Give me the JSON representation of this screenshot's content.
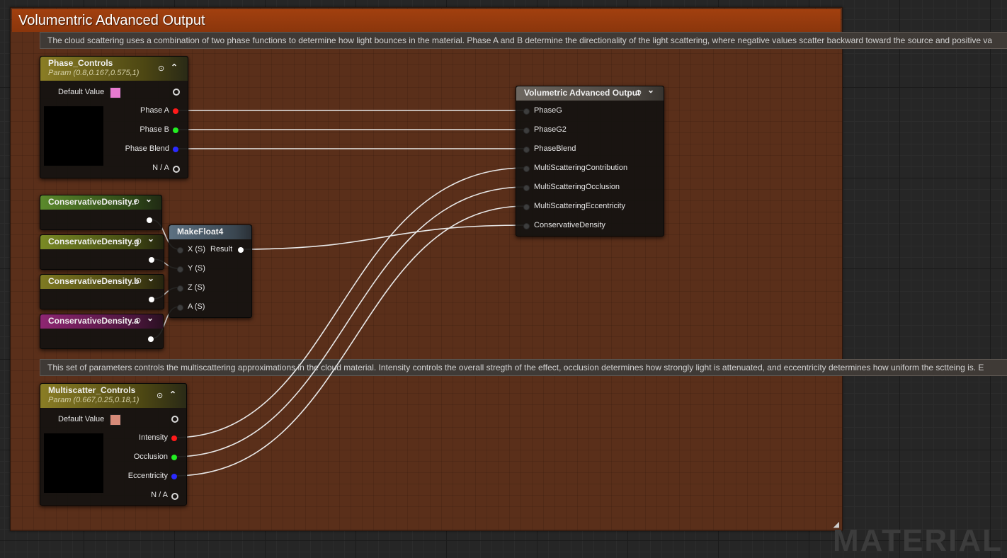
{
  "comment": {
    "title": "Volumentric Advanced Output",
    "resize_glyph": "◢",
    "color": "#5a2f1a",
    "header_color": "#8b360c"
  },
  "bubbles": {
    "phase_note": "The cloud scattering uses a combination of two phase functions to determine how light bounces in the material.  Phase A and B determine the directionality of the light scattering, where negative values scatter backward toward the source and positive va",
    "multiscatter_note": "This set of parameters controls the multiscattering approximations in the cloud material.  Intensity controls the overall stregth of the effect, occlusion determines how strongly light is attenuated, and eccentricity determines how uniform the sctteing is.  E"
  },
  "phase_controls": {
    "title": "Phase_Controls",
    "subtitle": "Param (0.8,0.167,0.575,1)",
    "default_value_label": "Default Value",
    "swatch_color": "#e77bd0",
    "pins": [
      "Phase A",
      "Phase B",
      "Phase Blend",
      "N / A"
    ]
  },
  "conservative_nodes": [
    {
      "title": "ConservativeDensity.r",
      "color": "#5b8a2c"
    },
    {
      "title": "ConservativeDensity.g",
      "color": "#7a8a25"
    },
    {
      "title": "ConservativeDensity.b",
      "color": "#7f7a22"
    },
    {
      "title": "ConservativeDensity.a",
      "color": "#8e2672"
    }
  ],
  "make_float4": {
    "title": "MakeFloat4",
    "inputs": [
      "X (S)",
      "Y (S)",
      "Z (S)",
      "A (S)"
    ],
    "output": "Result"
  },
  "output_node": {
    "title": "Volumetric Advanced Output",
    "inputs": [
      "PhaseG",
      "PhaseG2",
      "PhaseBlend",
      "MultiScatteringContribution",
      "MultiScatteringOcclusion",
      "MultiScatteringEccentricity",
      "ConservativeDensity"
    ]
  },
  "multiscatter_controls": {
    "title": "Multiscatter_Controls",
    "subtitle": "Param (0.667,0.25,0.18,1)",
    "default_value_label": "Default Value",
    "swatch_color": "#d68a78",
    "pins": [
      "Intensity",
      "Occlusion",
      "Eccentricity",
      "N / A"
    ]
  },
  "icons": {
    "options": "⊙",
    "collapse_up": "⌃",
    "collapse_down": "⌄"
  },
  "watermark": "MATERIAL"
}
